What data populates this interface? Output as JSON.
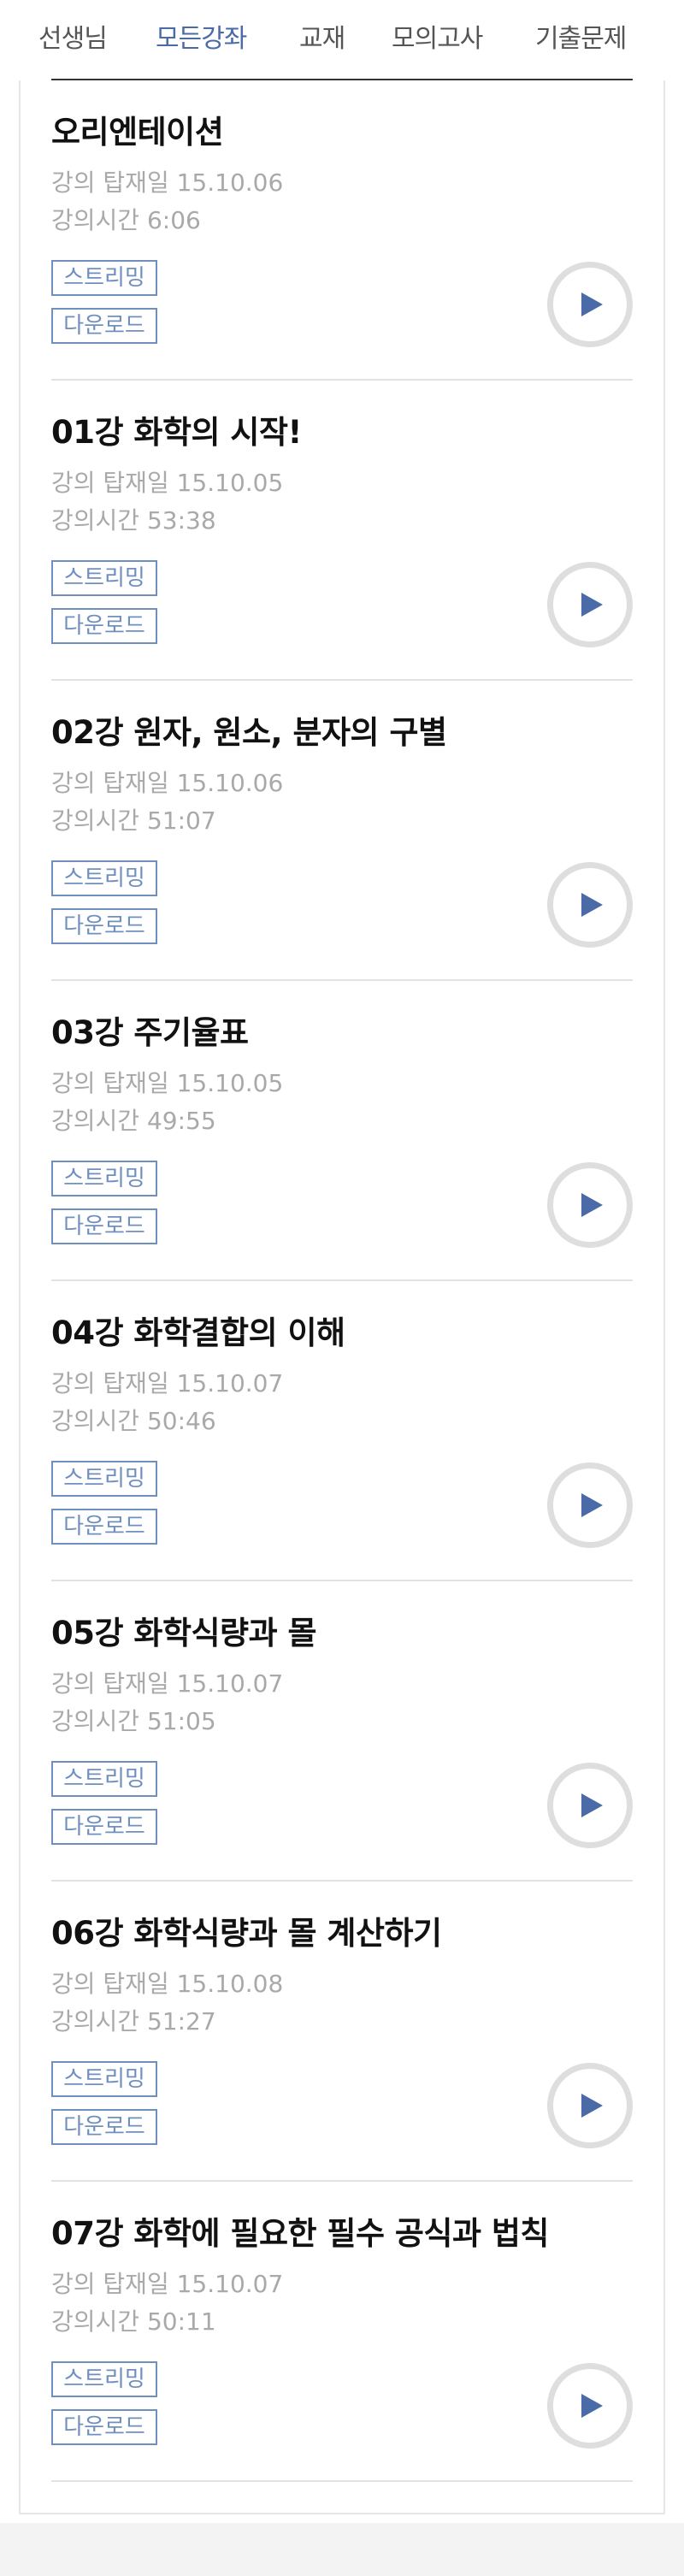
{
  "nav": {
    "tabs": [
      {
        "label": "선생님",
        "active": false
      },
      {
        "label": "모든강좌",
        "active": true
      },
      {
        "label": "교재",
        "active": false
      },
      {
        "label": "모의고사",
        "active": false
      },
      {
        "label": "기출문제",
        "active": false
      }
    ]
  },
  "colors": {
    "accent": "#4a6aa8",
    "tag_border": "#6f8fbf",
    "meta_text": "#a9a9a9",
    "play_icon": "#4a6aa8"
  },
  "lectures": [
    {
      "title": "오리엔테이션",
      "date": "강의 탑재일 15.10.06",
      "duration": "강의시간 6:06",
      "stream_label": "스트리밍",
      "download_label": "다운로드",
      "play_icon": "play-icon"
    },
    {
      "title": "01강 화학의 시작!",
      "date": "강의 탑재일 15.10.05",
      "duration": "강의시간 53:38",
      "stream_label": "스트리밍",
      "download_label": "다운로드",
      "play_icon": "play-icon"
    },
    {
      "title": "02강 원자, 원소, 분자의 구별",
      "date": "강의 탑재일 15.10.06",
      "duration": "강의시간 51:07",
      "stream_label": "스트리밍",
      "download_label": "다운로드",
      "play_icon": "play-icon"
    },
    {
      "title": "03강 주기율표",
      "date": "강의 탑재일 15.10.05",
      "duration": "강의시간 49:55",
      "stream_label": "스트리밍",
      "download_label": "다운로드",
      "play_icon": "play-icon"
    },
    {
      "title": "04강 화학결합의 이해",
      "date": "강의 탑재일 15.10.07",
      "duration": "강의시간 50:46",
      "stream_label": "스트리밍",
      "download_label": "다운로드",
      "play_icon": "play-icon"
    },
    {
      "title": "05강 화학식량과 몰",
      "date": "강의 탑재일 15.10.07",
      "duration": "강의시간 51:05",
      "stream_label": "스트리밍",
      "download_label": "다운로드",
      "play_icon": "play-icon"
    },
    {
      "title": "06강 화학식량과 몰 계산하기",
      "date": "강의 탑재일 15.10.08",
      "duration": "강의시간 51:27",
      "stream_label": "스트리밍",
      "download_label": "다운로드",
      "play_icon": "play-icon"
    },
    {
      "title": "07강 화학에 필요한 필수 공식과 법칙",
      "date": "강의 탑재일 15.10.07",
      "duration": "강의시간 50:11",
      "stream_label": "스트리밍",
      "download_label": "다운로드",
      "play_icon": "play-icon"
    }
  ]
}
